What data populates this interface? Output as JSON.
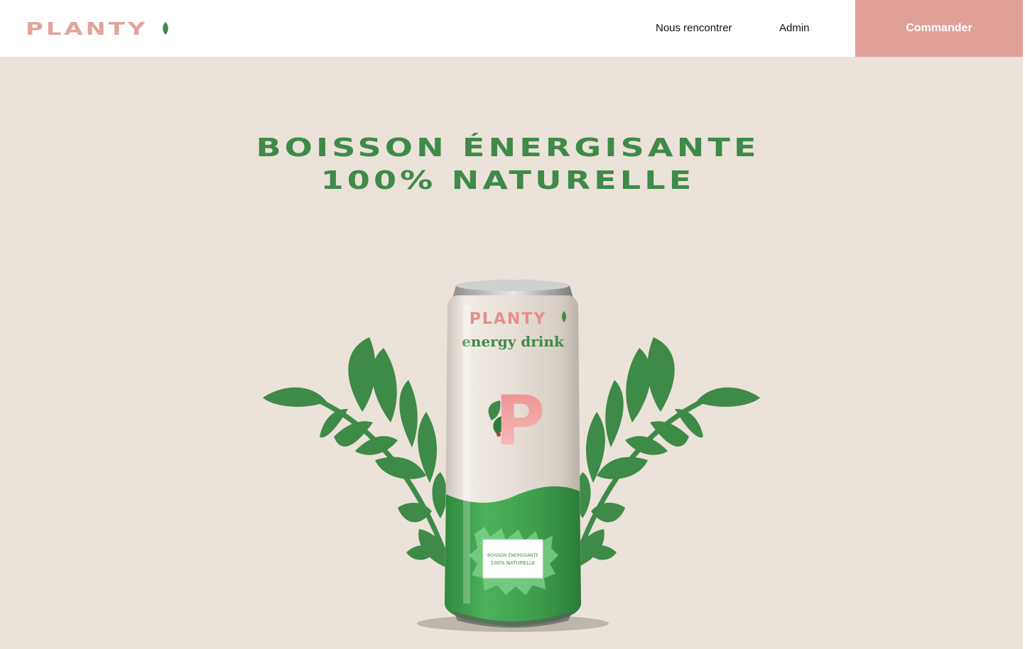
{
  "header": {
    "logo_text": "PLANTY",
    "logo_icon": "leaf-icon",
    "nav": [
      {
        "label": "Nous rencontrer"
      },
      {
        "label": "Admin"
      }
    ],
    "order_button": "Commander"
  },
  "hero": {
    "title_line1": "BOISSON ÉNERGISANTE",
    "title_line2": "100% NATURELLE",
    "can": {
      "brand": "PLANTY",
      "subtitle": "energy drink",
      "letter": "P",
      "label_line1": "BOISSON ÉNERGISANTE",
      "label_line2": "100% NATURELLE"
    }
  },
  "colors": {
    "brand_pink": "#e0a098",
    "brand_green": "#3e8a47",
    "background": "#ebe2da",
    "header_bg": "#ffffff"
  }
}
